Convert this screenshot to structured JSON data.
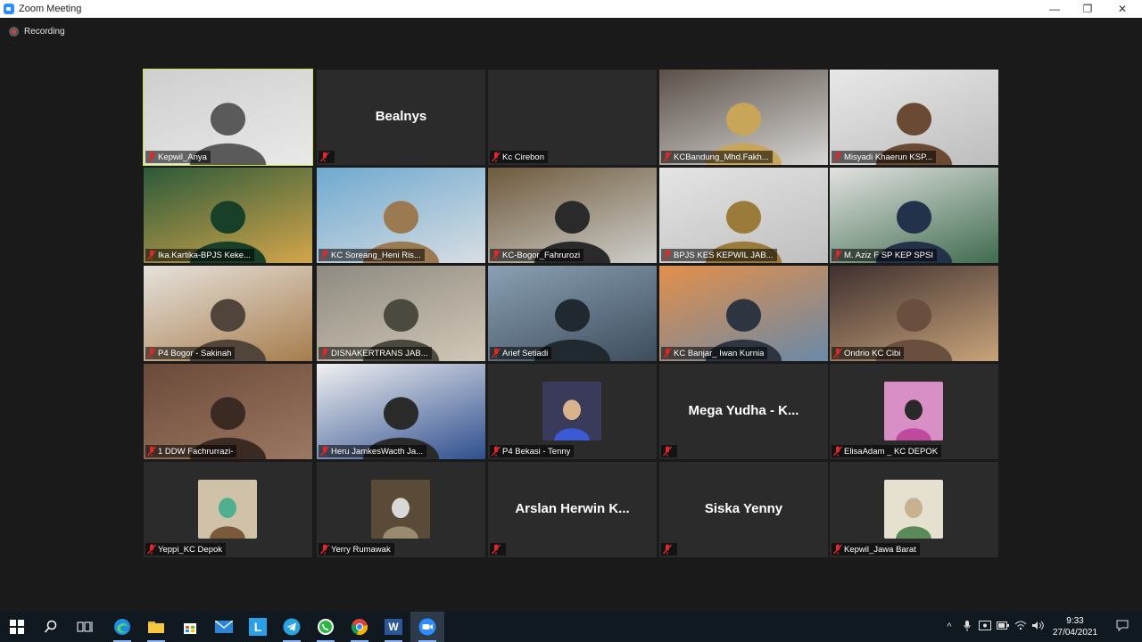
{
  "window": {
    "title": "Zoom Meeting",
    "minimize_label": "—",
    "maximize_label": "❐",
    "close_label": "✕"
  },
  "recording": {
    "label": "Recording"
  },
  "participants": [
    {
      "name": "Kepwil_Anya",
      "video": true,
      "active": true,
      "colors": [
        "#cfcfcf",
        "#e9e9e9",
        "#5a5a5a"
      ]
    },
    {
      "name": "",
      "display": "Bealnys",
      "video": false
    },
    {
      "name": "Kc Cirebon",
      "video": false
    },
    {
      "name": "KCBandung_Mhd.Fakh...",
      "video": true,
      "colors": [
        "#5a5048",
        "#d8d6d4",
        "#c9a55a"
      ]
    },
    {
      "name": "Misyadi Khaerun KSP...",
      "video": true,
      "colors": [
        "#e8e8e8",
        "#bdbdbd",
        "#6b4a33"
      ]
    },
    {
      "name": "Ika.Kartika-BPJS Keke...",
      "video": true,
      "colors": [
        "#2c5a3a",
        "#d4a64a",
        "#184028"
      ]
    },
    {
      "name": "KC Soreang_Heni Ris...",
      "video": true,
      "colors": [
        "#6fa9cf",
        "#d8dee3",
        "#9b7a52"
      ]
    },
    {
      "name": "KC-Bogor_Fahrurozi",
      "video": true,
      "colors": [
        "#6e5a3c",
        "#d0cfcc",
        "#2a2a2a"
      ]
    },
    {
      "name": "BPJS KES KEPWIL JAB...",
      "video": true,
      "colors": [
        "#e4e4e4",
        "#bfbfbf",
        "#9a7b3a"
      ]
    },
    {
      "name": "M. Aziz F SP KEP SPSI",
      "video": true,
      "colors": [
        "#e2e2e0",
        "#3f6c4f",
        "#24314a"
      ]
    },
    {
      "name": "P4 Bogor - Sakinah",
      "video": true,
      "colors": [
        "#e6e2dc",
        "#a77d4c",
        "#50443b"
      ]
    },
    {
      "name": "DISNAKERTRANS JAB...",
      "video": true,
      "colors": [
        "#8e8a80",
        "#d2c8b8",
        "#4c4a3e"
      ]
    },
    {
      "name": "Arief Setiadi",
      "video": true,
      "colors": [
        "#8ba0b4",
        "#3d4d5c",
        "#202830"
      ]
    },
    {
      "name": "KC Banjar_ Iwan Kurnia",
      "video": true,
      "colors": [
        "#e38f4a",
        "#6a89a8",
        "#2c3540"
      ]
    },
    {
      "name": "Ondrio KC Cibi",
      "video": true,
      "colors": [
        "#3e2f2f",
        "#c9a47a",
        "#6a4e3e"
      ]
    },
    {
      "name": "1 DDW Fachrurrazi-",
      "video": true,
      "colors": [
        "#6b4a3a",
        "#9b7860",
        "#3a2a22"
      ]
    },
    {
      "name": "Heru JamkesWacth Ja...",
      "video": true,
      "colors": [
        "#f0f0f0",
        "#2f4f8f",
        "#2a2a2a"
      ]
    },
    {
      "name": "P4 Bekasi - Tenny",
      "video": "small",
      "colors": [
        "#3a3a5a",
        "#3b5bd6",
        "#d9b38c"
      ]
    },
    {
      "name": "",
      "display": "Mega Yudha - K...",
      "video": false
    },
    {
      "name": "ElisaAdam _ KC DEPOK",
      "video": "small",
      "colors": [
        "#d88fc6",
        "#c04aa0",
        "#2a2a2a"
      ]
    },
    {
      "name": "Yeppi_KC Depok",
      "video": "small",
      "colors": [
        "#cfc2a8",
        "#7a5a3a",
        "#4fb08f"
      ]
    },
    {
      "name": "Yerry Rumawak",
      "video": "small",
      "colors": [
        "#5a4a38",
        "#9a8a70",
        "#d8d8d8"
      ]
    },
    {
      "name": "",
      "display": "Arslan Herwin K...",
      "video": false
    },
    {
      "name": "",
      "display": "Siska Yenny",
      "video": false
    },
    {
      "name": "Kepwil_Jawa Barat",
      "video": "small",
      "colors": [
        "#e6e0d0",
        "#5a8a5a",
        "#c8b090"
      ]
    }
  ],
  "taskbar": {
    "apps": [
      "windows-start",
      "search",
      "task-view",
      "edge",
      "file-explorer",
      "store",
      "mail",
      "app-l",
      "telegram",
      "whatsapp",
      "chrome",
      "word",
      "zoom"
    ],
    "app_l_label": "L",
    "word_label": "W",
    "time": "9:33",
    "date": "27/04/2021"
  }
}
